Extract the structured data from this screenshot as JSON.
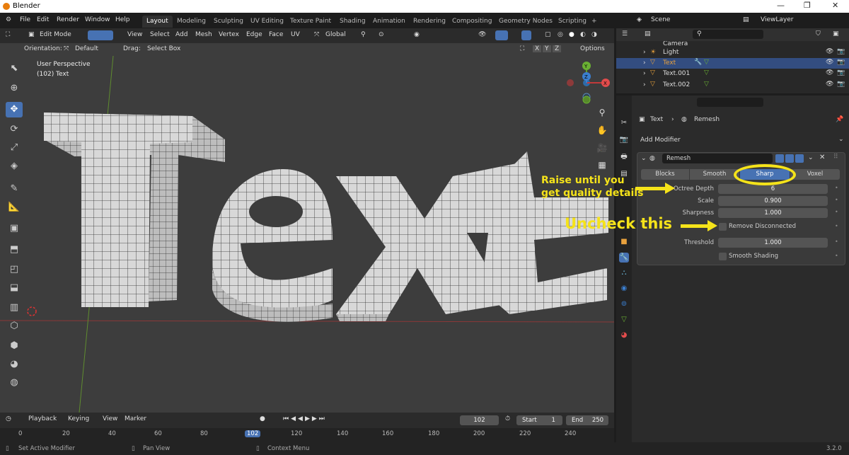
{
  "window": {
    "title": "Blender",
    "controls": [
      "—",
      "❐",
      "✕"
    ]
  },
  "menu": [
    "File",
    "Edit",
    "Render",
    "Window",
    "Help"
  ],
  "workspaces": [
    "Layout",
    "Modeling",
    "Sculpting",
    "UV Editing",
    "Texture Paint",
    "Shading",
    "Animation",
    "Rendering",
    "Compositing",
    "Geometry Nodes",
    "Scripting",
    "+"
  ],
  "scene": {
    "scene_label": "Scene",
    "viewlayer_label": "ViewLayer"
  },
  "viewport_header": {
    "mode": "Edit Mode",
    "menus": [
      "View",
      "Select",
      "Add",
      "Mesh",
      "Vertex",
      "Edge",
      "Face",
      "UV"
    ],
    "transform": "Global",
    "orientation_label": "Orientation:",
    "orientation_value": "Default",
    "drag_label": "Drag:",
    "drag_value": "Select Box",
    "axes": [
      "X",
      "Y",
      "Z"
    ],
    "options": "Options"
  },
  "viewport": {
    "info_line1": "User Perspective",
    "info_line2": "(102) Text",
    "mesh_text": "Text",
    "gizmo": {
      "x": "X",
      "y": "Y",
      "z": "Z"
    }
  },
  "timeline": {
    "menus": [
      "Playback",
      "Keying",
      "View",
      "Marker"
    ],
    "current_frame": "102",
    "start_label": "Start",
    "start_value": "1",
    "end_label": "End",
    "end_value": "250",
    "ticks": [
      "0",
      "20",
      "40",
      "60",
      "80",
      "102",
      "120",
      "140",
      "160",
      "180",
      "200",
      "220",
      "240"
    ]
  },
  "statusbar": {
    "left": "Set Active Modifier",
    "mid": "Pan View",
    "right": "Context Menu",
    "version": "3.2.0"
  },
  "outliner": {
    "rows": [
      {
        "name": "Camera",
        "selected": false
      },
      {
        "name": "Light",
        "selected": false
      },
      {
        "name": "Text",
        "selected": true
      },
      {
        "name": "Text.001",
        "selected": false
      },
      {
        "name": "Text.002",
        "selected": false
      }
    ]
  },
  "properties": {
    "breadcrumb_object": "Text",
    "breadcrumb_modifier": "Remesh",
    "add_modifier": "Add Modifier",
    "modifier_name": "Remesh",
    "modes": [
      "Blocks",
      "Smooth",
      "Sharp",
      "Voxel"
    ],
    "active_mode": "Sharp",
    "fields": {
      "octree_label": "Octree Depth",
      "octree_value": "6",
      "scale_label": "Scale",
      "scale_value": "0.900",
      "sharpness_label": "Sharpness",
      "sharpness_value": "1.000",
      "remove_label": "Remove Disconnected",
      "threshold_label": "Threshold",
      "threshold_value": "1.000",
      "smooth_label": "Smooth Shading"
    }
  },
  "annotations": {
    "raise_line1": "Raise until you",
    "raise_line2": "get quality details",
    "uncheck": "Uncheck this"
  },
  "colors": {
    "accent": "#4772b3",
    "annotation": "#f5e31a",
    "viewport": "#3d3d3d",
    "mesh": "#d6d6d6"
  }
}
